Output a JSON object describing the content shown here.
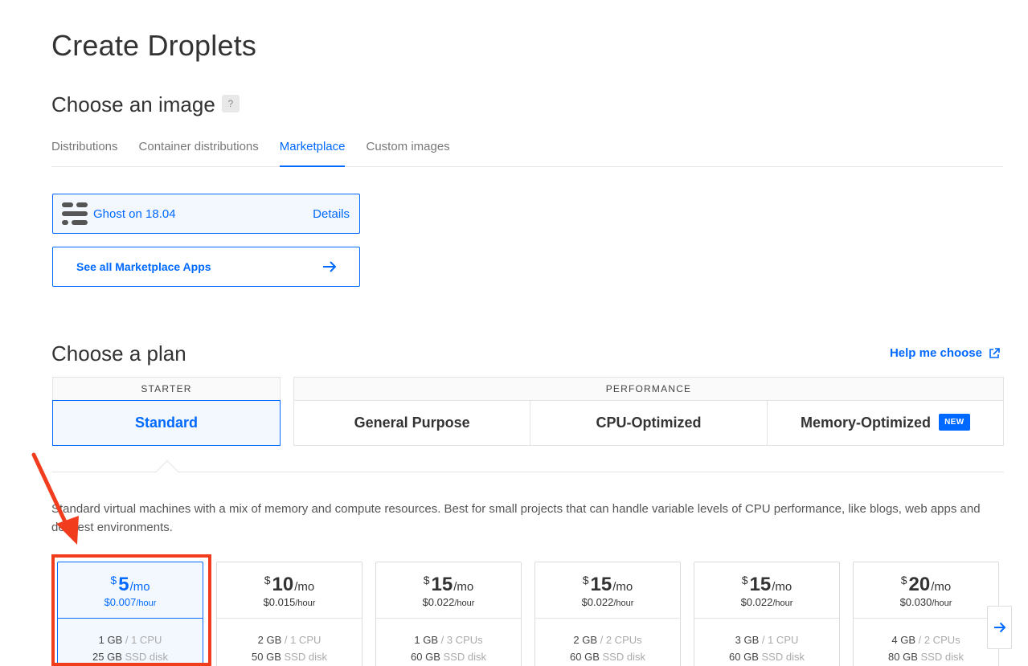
{
  "page": {
    "title": "Create Droplets"
  },
  "image_section": {
    "title": "Choose an image",
    "help": "?",
    "tabs": [
      {
        "label": "Distributions",
        "active": false
      },
      {
        "label": "Container distributions",
        "active": false
      },
      {
        "label": "Marketplace",
        "active": true
      },
      {
        "label": "Custom images",
        "active": false
      }
    ],
    "selected_image": {
      "name": "Ghost on 18.04",
      "details_label": "Details",
      "icon": "ghost-logo-icon"
    },
    "see_all_label": "See all Marketplace Apps"
  },
  "plan_section": {
    "title": "Choose a plan",
    "help_link": "Help me choose",
    "starter": {
      "label": "STARTER",
      "options": [
        "Standard"
      ]
    },
    "performance": {
      "label": "PERFORMANCE",
      "options": [
        "General Purpose",
        "CPU-Optimized",
        "Memory-Optimized"
      ],
      "new_badge": "NEW"
    },
    "description": "Standard virtual machines with a mix of memory and compute resources. Best for small projects that can handle variable levels of CPU performance, like blogs, web apps and dev/test environments.",
    "prices": [
      {
        "dollar": "$",
        "amount": "5",
        "per": "/mo",
        "hourly": "$0.007",
        "hour_unit": "/hour",
        "ram": "1 GB",
        "cpu": "/ 1 CPU",
        "disk": "25 GB",
        "disk_type": "SSD disk",
        "selected": true
      },
      {
        "dollar": "$",
        "amount": "10",
        "per": "/mo",
        "hourly": "$0.015",
        "hour_unit": "/hour",
        "ram": "2 GB",
        "cpu": "/ 1 CPU",
        "disk": "50 GB",
        "disk_type": "SSD disk",
        "selected": false
      },
      {
        "dollar": "$",
        "amount": "15",
        "per": "/mo",
        "hourly": "$0.022",
        "hour_unit": "/hour",
        "ram": "1 GB",
        "cpu": "/ 3 CPUs",
        "disk": "60 GB",
        "disk_type": "SSD disk",
        "selected": false
      },
      {
        "dollar": "$",
        "amount": "15",
        "per": "/mo",
        "hourly": "$0.022",
        "hour_unit": "/hour",
        "ram": "2 GB",
        "cpu": "/ 2 CPUs",
        "disk": "60 GB",
        "disk_type": "SSD disk",
        "selected": false
      },
      {
        "dollar": "$",
        "amount": "15",
        "per": "/mo",
        "hourly": "$0.022",
        "hour_unit": "/hour",
        "ram": "3 GB",
        "cpu": "/ 1 CPU",
        "disk": "60 GB",
        "disk_type": "SSD disk",
        "selected": false
      },
      {
        "dollar": "$",
        "amount": "20",
        "per": "/mo",
        "hourly": "$0.030",
        "hour_unit": "/hour",
        "ram": "4 GB",
        "cpu": "/ 2 CPUs",
        "disk": "80 GB",
        "disk_type": "SSD disk",
        "selected": false
      }
    ]
  },
  "colors": {
    "accent": "#0069ff",
    "annotation": "#f23c1e",
    "border": "#e3e3e3"
  }
}
